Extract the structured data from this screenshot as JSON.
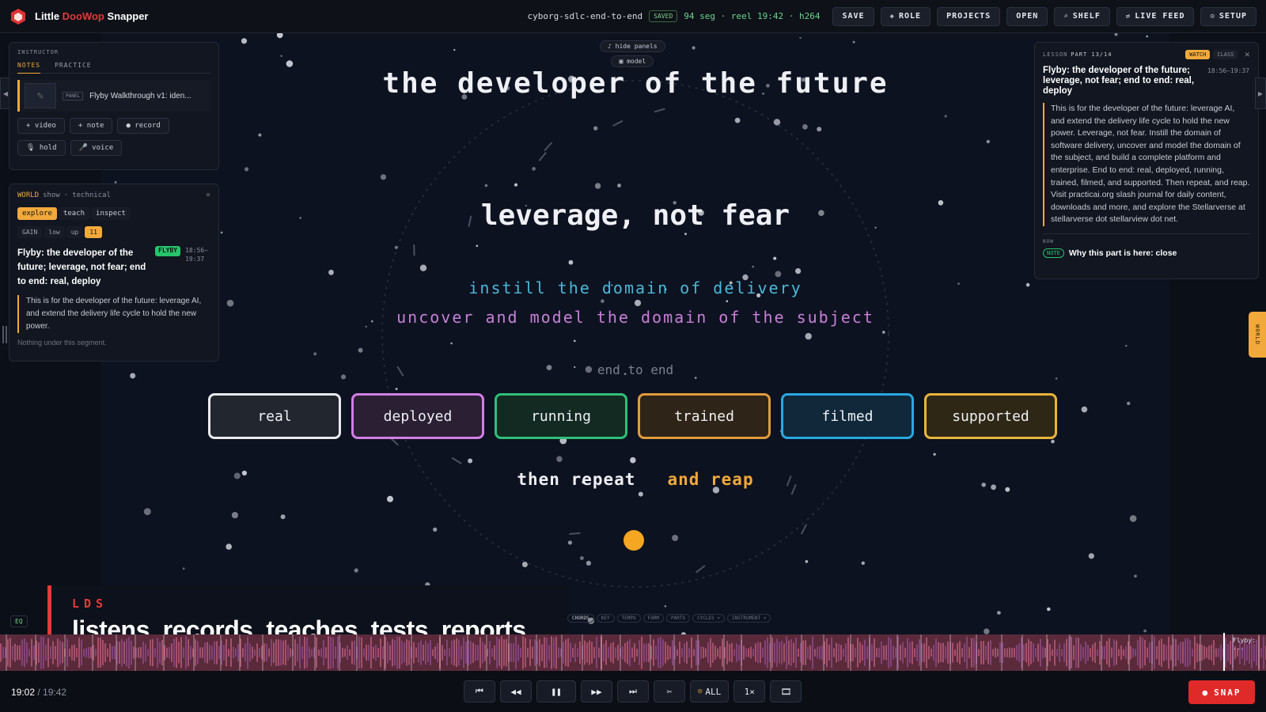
{
  "app": {
    "title_a": "Little ",
    "title_b": "DooWop",
    "title_c": " Snapper",
    "logo_icon": "hexagon-logo-icon"
  },
  "project": {
    "name": "cyborg-sdlc-end-to-end",
    "saved": "SAVED",
    "meta": "94 seg · reel 19:42 · h264"
  },
  "toolbar": {
    "save": "SAVE",
    "role": "ROLE",
    "projects": "PROJECTS",
    "open": "OPEN",
    "shelf": "SHELF",
    "live_feed": "LIVE FEED",
    "setup": "SETUP"
  },
  "stage": {
    "float_hide": "♪ hide panels",
    "float_model": "▣ model",
    "title": "the developer of the future",
    "subtitle": "leverage, not fear",
    "line1": "instill the domain of delivery",
    "line2": "uncover and model the domain of the subject",
    "e2e": "end to end",
    "pills": [
      {
        "label": "real",
        "color": "#e8eaee",
        "bg": "#22262f"
      },
      {
        "label": "deployed",
        "color": "#d27ee6",
        "bg": "#2a1f33"
      },
      {
        "label": "running",
        "color": "#2fbf78",
        "bg": "#132a22"
      },
      {
        "label": "trained",
        "color": "#e09b3d",
        "bg": "#2e2417"
      },
      {
        "label": "filmed",
        "color": "#28a8e0",
        "bg": "#10283a"
      },
      {
        "label": "supported",
        "color": "#e9b43c",
        "bg": "#2e2715"
      }
    ],
    "repeat_a": "then repeat",
    "repeat_b": "and reap"
  },
  "instructor": {
    "label": "INSTRUCTOR",
    "tabs": [
      "NOTES",
      "PRACTICE"
    ],
    "panel_badge": "PANEL",
    "media_title": "Flyby Walkthrough v1: iden...",
    "chips_row1": [
      "+ video",
      "+ note",
      "● record"
    ],
    "chips_row2": [
      "🎙 hold",
      "🎤 voice"
    ]
  },
  "world": {
    "title": "WORLD",
    "show": "show",
    "sep": "·",
    "mode": "technical",
    "modes": [
      "explore",
      "teach",
      "inspect"
    ],
    "gain": [
      "GAIN",
      "low",
      "up",
      "11"
    ],
    "seg_title": "Flyby: the developer of the future; leverage, not fear; end to end: real, deploy",
    "badge": "FLYBY",
    "time": "18:56–\n19:37",
    "desc": "This is for the developer of the future: leverage AI, and extend the delivery life cycle to hold the new power.",
    "nothing": "Nothing under this segment.",
    "tab_label": "WORLD"
  },
  "lesson": {
    "label": "LESSON",
    "part": "PART 13/14",
    "watch": "WATCH",
    "class": "CLASS",
    "title": "Flyby: the developer of the future; leverage, not fear; end to end: real, deploy",
    "time": "18:56–19:37",
    "body": "This is for the developer of the future: leverage AI, and extend the delivery life cycle to hold the new power. Leverage, not fear. Instill the domain of software delivery, uncover and model the domain of the subject, and build a complete platform and enterprise. End to end: real, deployed, running, trained, filmed, and supported. Then repeat, and reap. Visit practicai.org slash journal for daily content, downloads and more, and explore the Stellarverse at stellarverse dot stellarview dot net.",
    "now": "NOW",
    "note_badge": "NOTE",
    "note_text": "Why this part is here: close"
  },
  "lower_third": {
    "kicker": "LDS",
    "text": "listens, records, teaches, tests, reports"
  },
  "eq": "EQ",
  "timeline_tabs": [
    "CHORDS",
    "KEY",
    "TEMPO",
    "FORM",
    "PARTS",
    "CYCLES ▾",
    "INSTRUMENT ▾"
  ],
  "timeline": {
    "end_label": "Flyby: ..."
  },
  "transport": {
    "time_current": "19:02",
    "time_sep": " / ",
    "time_total": "19:42",
    "buttons": [
      "⏮",
      "◀◀",
      "❚❚",
      "▶▶",
      "⏭",
      "✂"
    ],
    "all": "ALL",
    "speed": "1×",
    "film": "🎞",
    "snap": "SNAP"
  }
}
